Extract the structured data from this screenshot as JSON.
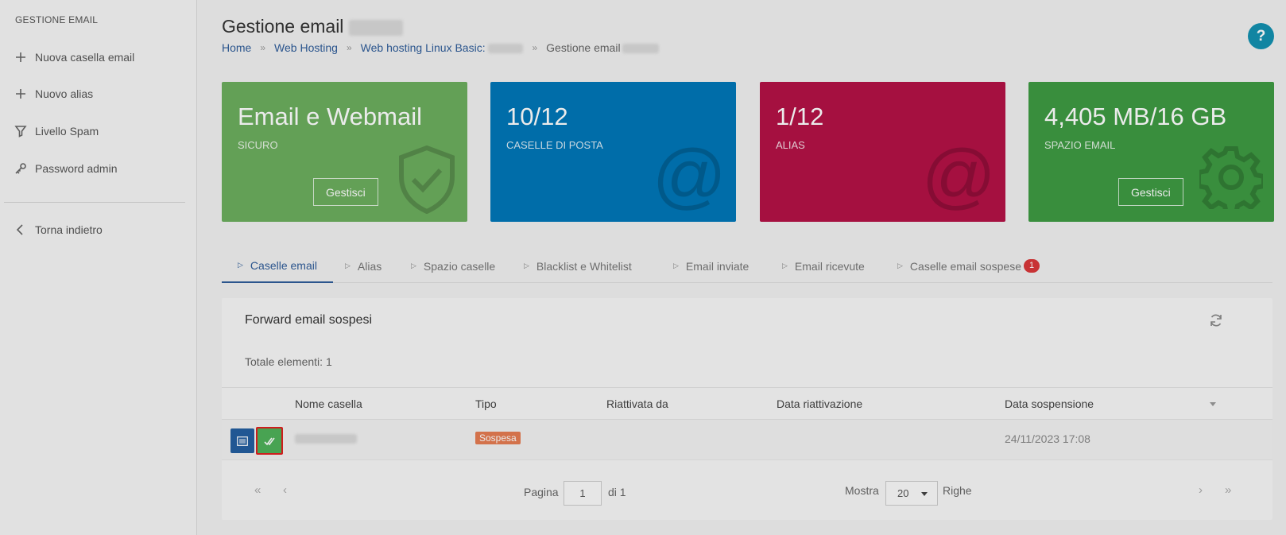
{
  "sidebar": {
    "title": "GESTIONE EMAIL",
    "items": [
      {
        "label": "Nuova casella email",
        "icon": "plus-icon"
      },
      {
        "label": "Nuovo alias",
        "icon": "plus-icon"
      },
      {
        "label": "Livello Spam",
        "icon": "filter-icon"
      },
      {
        "label": "Password admin",
        "icon": "key-icon"
      }
    ],
    "back_label": "Torna indietro"
  },
  "header": {
    "title": "Gestione email",
    "breadcrumb": {
      "home": "Home",
      "web_hosting": "Web Hosting",
      "plan": "Web hosting Linux Basic:",
      "current": "Gestione email"
    },
    "help_label": "?"
  },
  "cards": [
    {
      "value": "Email e Webmail",
      "label": "SICURO",
      "button": "Gestisci",
      "color": "#6cae5e",
      "icon": "shield-check-icon"
    },
    {
      "value": "10/12",
      "label": "CASELLE DI POSTA",
      "color": "#0077b8",
      "icon": "at-icon"
    },
    {
      "value": "1/12",
      "label": "ALIAS",
      "color": "#b31246",
      "icon": "at-icon"
    },
    {
      "value": "4,405 MB/16 GB",
      "label": "SPAZIO EMAIL",
      "button": "Gestisci",
      "color": "#3e9b43",
      "icon": "gear-icon"
    }
  ],
  "tabs": [
    {
      "label": "Caselle email",
      "active": true
    },
    {
      "label": "Alias"
    },
    {
      "label": "Spazio caselle"
    },
    {
      "label": "Blacklist e Whitelist"
    },
    {
      "label": "Email inviate"
    },
    {
      "label": "Email ricevute"
    },
    {
      "label": "Caselle email sospese",
      "badge": "1"
    }
  ],
  "panel": {
    "title": "Forward email sospesi",
    "total": "Totale elementi: 1",
    "columns": [
      "Nome casella",
      "Tipo",
      "Riattivata da",
      "Data riattivazione",
      "Data sospensione"
    ],
    "rows": [
      {
        "status": "Sospesa",
        "data_sospensione": "24/11/2023 17:08"
      }
    ],
    "pager": {
      "page_label": "Pagina",
      "page": "1",
      "of_label": "di 1",
      "show_label": "Mostra",
      "rows_value": "20",
      "rows_label": "Righe",
      "first": "«",
      "prev": "‹",
      "next": "›",
      "last": "»"
    }
  }
}
